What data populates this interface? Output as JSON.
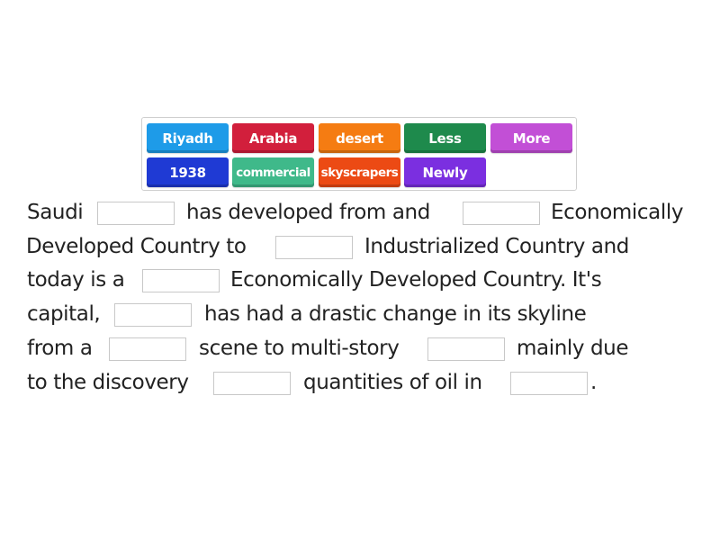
{
  "tiles": [
    {
      "label": "Riyadh",
      "color": "#1e9be8"
    },
    {
      "label": "Arabia",
      "color": "#d21f3c"
    },
    {
      "label": "desert",
      "color": "#f57c12"
    },
    {
      "label": "Less",
      "color": "#1e8a4c"
    },
    {
      "label": "More",
      "color": "#c24fd6"
    },
    {
      "label": "1938",
      "color": "#1f3ad4"
    },
    {
      "label": "commercial",
      "color": "#3fb98a"
    },
    {
      "label": "skyscrapers",
      "color": "#ec4a14"
    },
    {
      "label": "Newly",
      "color": "#7b2fe0"
    }
  ],
  "text": {
    "l1a": "Saudi",
    "l1b": "has developed from and",
    "l1c": "Economically",
    "l2a": "Developed Country to",
    "l2b": "Industrialized Country and",
    "l3a": "today is a",
    "l3b": "Economically Developed Country. It's",
    "l4a": "capital,",
    "l4b": "has had a drastic change in its skyline",
    "l5a": "from a",
    "l5b": "scene to multi-story",
    "l5c": "mainly due",
    "l6a": "to the discovery",
    "l6b": "quantities of oil in",
    "l6c": "."
  },
  "blanks": [
    "",
    "",
    "",
    "",
    "",
    "",
    "",
    "",
    ""
  ]
}
